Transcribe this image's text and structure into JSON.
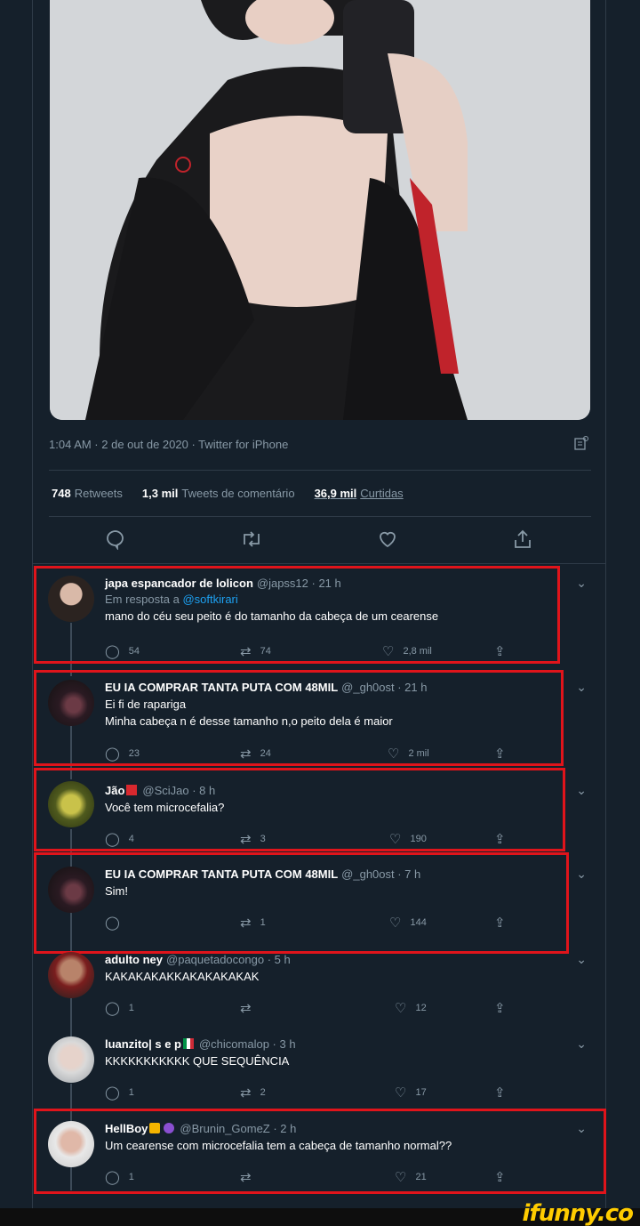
{
  "tweet": {
    "meta": "1:04 AM · 2 de out de 2020 · Twitter for iPhone",
    "retweets_count": "748",
    "retweets_label": "Retweets",
    "comments_count": "1,3 mil",
    "comments_label": "Tweets de comentário",
    "likes_count": "36,9 mil",
    "likes_label": "Curtidas"
  },
  "replies": [
    {
      "name": "japa espancador de lolicon",
      "handle": "@japss12 · 21 h",
      "reply_prefix": "Em resposta a",
      "reply_to": "@softkirari",
      "text": "mano do céu seu peito é do tamanho da cabeça de um cearense",
      "comments": "54",
      "retweets": "74",
      "likes": "2,8 mil"
    },
    {
      "name": "EU IA COMPRAR TANTA PUTA COM 48MIL",
      "handle": "@_gh0ost · 21 h",
      "text": "Ei fi de rapariga",
      "text2": "Minha cabeça n é desse tamanho n,o peito dela é maior",
      "comments": "23",
      "retweets": "24",
      "likes": "2 mil"
    },
    {
      "name": "Jão",
      "handle": "@SciJao · 8 h",
      "text": "Você tem microcefalia?",
      "comments": "4",
      "retweets": "3",
      "likes": "190"
    },
    {
      "name": "EU IA COMPRAR TANTA PUTA COM 48MIL",
      "handle": "@_gh0ost · 7 h",
      "text": "Sim!",
      "comments": "",
      "retweets": "1",
      "likes": "144"
    },
    {
      "name": "adulto ney",
      "handle": "@paquetadocongo · 5 h",
      "text": "KAKAKAKAKKAKAKAKAKAK",
      "comments": "1",
      "retweets": "",
      "likes": "12"
    },
    {
      "name": "luanzito| s e p",
      "handle": "@chicomalop · 3 h",
      "text": "KKKKKKKKKKK QUE SEQUÊNCIA",
      "comments": "1",
      "retweets": "2",
      "likes": "17"
    },
    {
      "name": "HellBoy",
      "handle": "@Brunin_GomeZ · 2 h",
      "text": "Um cearense com microcefalia tem a cabeça de tamanho normal??",
      "comments": "1",
      "retweets": "",
      "likes": "21"
    }
  ],
  "watermark": "ifunny.co",
  "icons": {
    "comment": "speech-bubble-icon",
    "retweet": "retweet-arrows-icon",
    "like": "heart-icon",
    "share": "share-upload-icon",
    "more": "chevron-down-icon"
  },
  "colors": {
    "background": "#15202b",
    "muted": "#8899a6",
    "link": "#1da1f2",
    "highlight": "#e0141b",
    "watermark": "#ffcc00"
  }
}
